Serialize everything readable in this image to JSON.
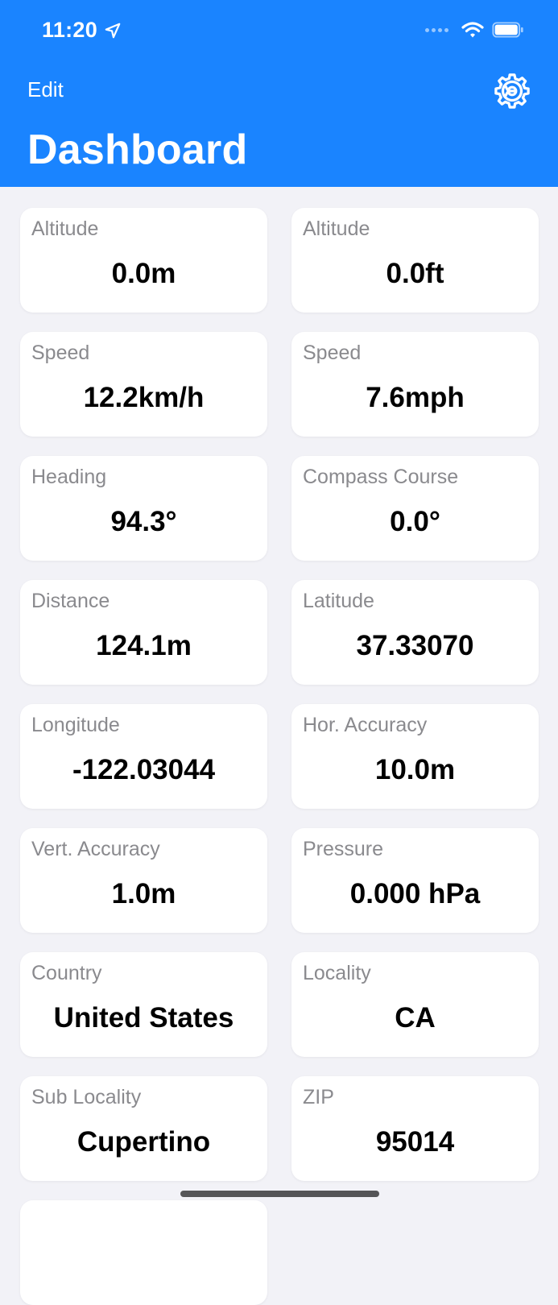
{
  "status_bar": {
    "time": "11:20"
  },
  "nav": {
    "edit_label": "Edit",
    "title": "Dashboard"
  },
  "colors": {
    "header_bg": "#1a84ff",
    "page_bg": "#f2f2f7",
    "card_bg": "#ffffff",
    "label_color": "#8a8a8e"
  },
  "icons": {
    "settings": "gear-icon",
    "location": "location-arrow-icon",
    "wifi": "wifi-icon",
    "battery": "battery-icon"
  },
  "cards": [
    {
      "label": "Altitude",
      "value": "0.0m"
    },
    {
      "label": "Altitude",
      "value": "0.0ft"
    },
    {
      "label": "Speed",
      "value": "12.2km/h"
    },
    {
      "label": "Speed",
      "value": "7.6mph"
    },
    {
      "label": "Heading",
      "value": "94.3°"
    },
    {
      "label": "Compass Course",
      "value": "0.0°"
    },
    {
      "label": "Distance",
      "value": "124.1m"
    },
    {
      "label": "Latitude",
      "value": "37.33070"
    },
    {
      "label": "Longitude",
      "value": "-122.03044"
    },
    {
      "label": "Hor. Accuracy",
      "value": "10.0m"
    },
    {
      "label": "Vert. Accuracy",
      "value": "1.0m"
    },
    {
      "label": "Pressure",
      "value": "0.000 hPa"
    },
    {
      "label": "Country",
      "value": "United States"
    },
    {
      "label": "Locality",
      "value": "CA"
    },
    {
      "label": "Sub Locality",
      "value": "Cupertino"
    },
    {
      "label": "ZIP",
      "value": "95014"
    }
  ]
}
